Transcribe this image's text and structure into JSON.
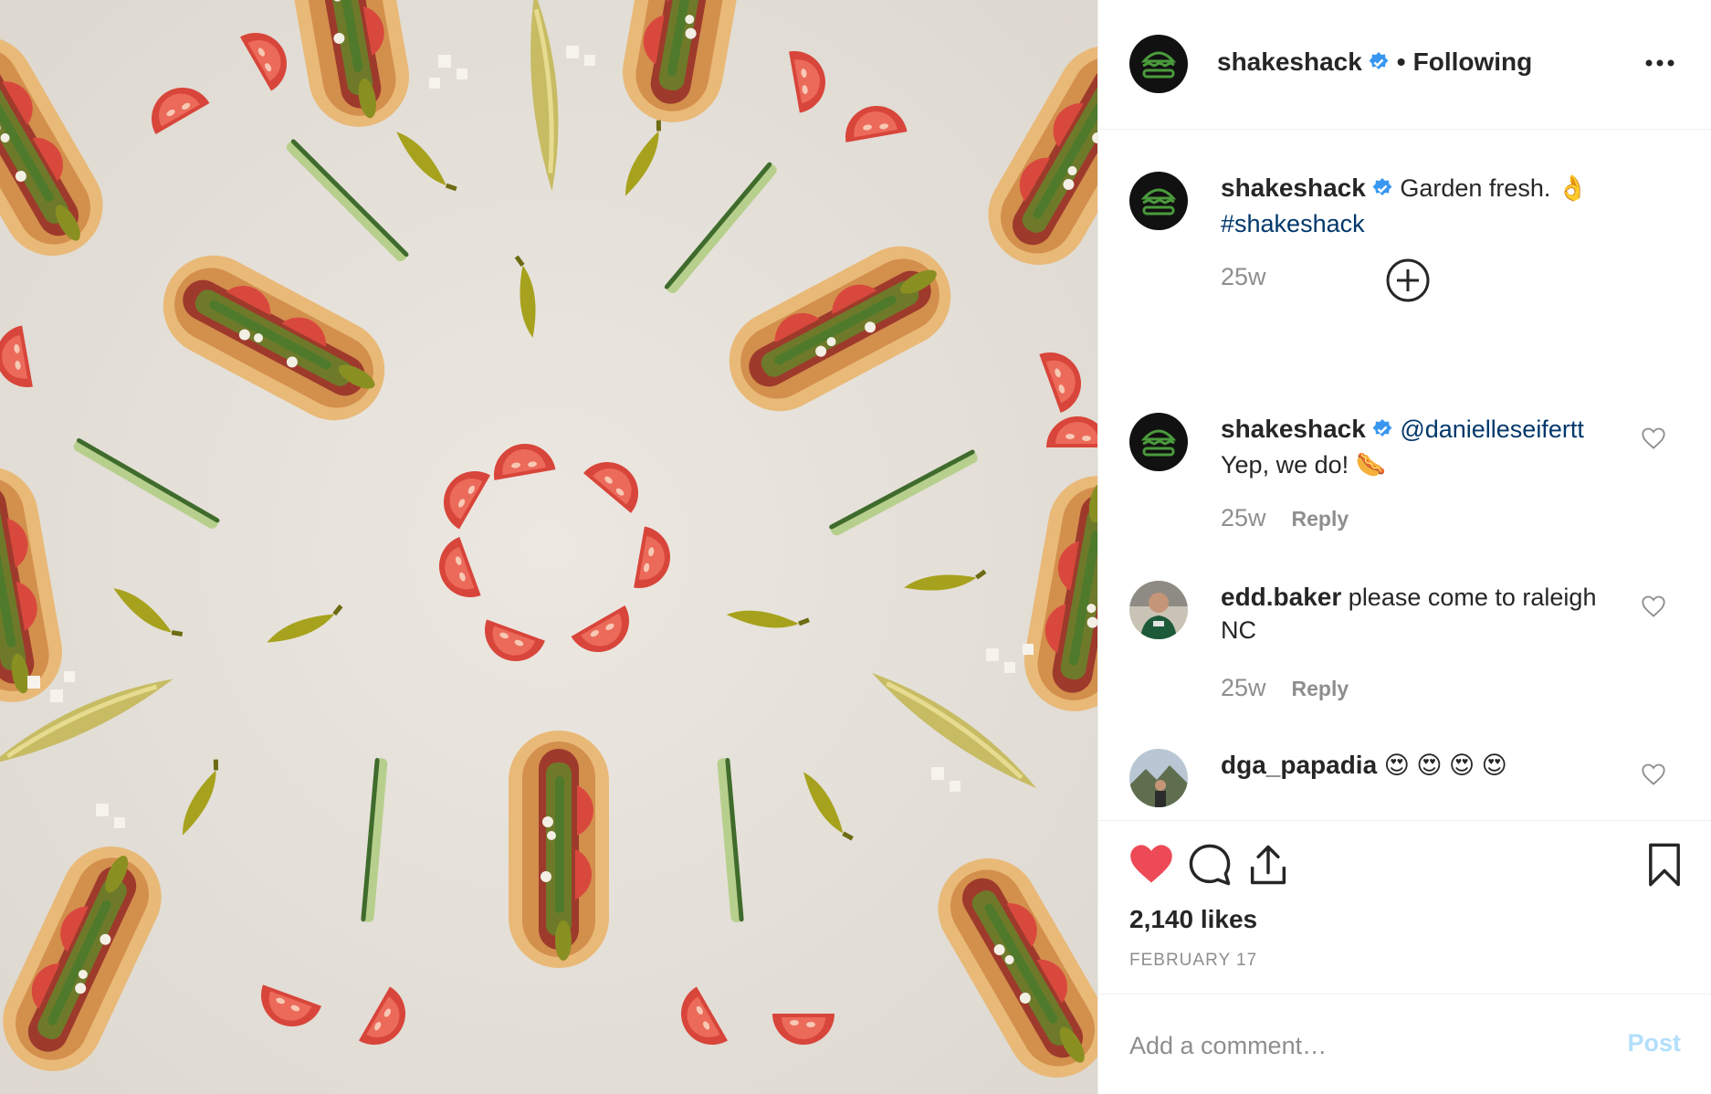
{
  "post": {
    "author": "shakeshack",
    "follow_separator": "•",
    "follow_status": "Following",
    "photo_alt": "Hot dogs, tomatoes, pickles and peppers arranged in a radial pattern"
  },
  "caption": {
    "author": "shakeshack",
    "text": "Garden fresh. 👌",
    "hashtag": "#shakeshack",
    "age": "25w"
  },
  "comments": [
    {
      "author": "shakeshack",
      "mention": "@danielleseifertt",
      "text": "Yep, we do! 🌭",
      "age": "25w",
      "reply_label": "Reply"
    },
    {
      "author": "edd.baker",
      "text": "please come to raleigh NC",
      "age": "25w",
      "reply_label": "Reply"
    },
    {
      "author": "dga_papadia",
      "text": "😍 😍 😍 😍"
    }
  ],
  "actions": {
    "likes": "2,140 likes",
    "date": "FEBRUARY 17",
    "liked": true,
    "like_color": "#ed4956"
  },
  "composer": {
    "placeholder": "Add a comment…",
    "post_label": "Post"
  },
  "icons": {
    "more": "more-options-icon",
    "load_more": "plus-circle-icon",
    "like": "heart-icon",
    "comment": "comment-bubble-icon",
    "share": "share-icon",
    "save": "bookmark-icon",
    "verified": "verified-badge-icon"
  }
}
